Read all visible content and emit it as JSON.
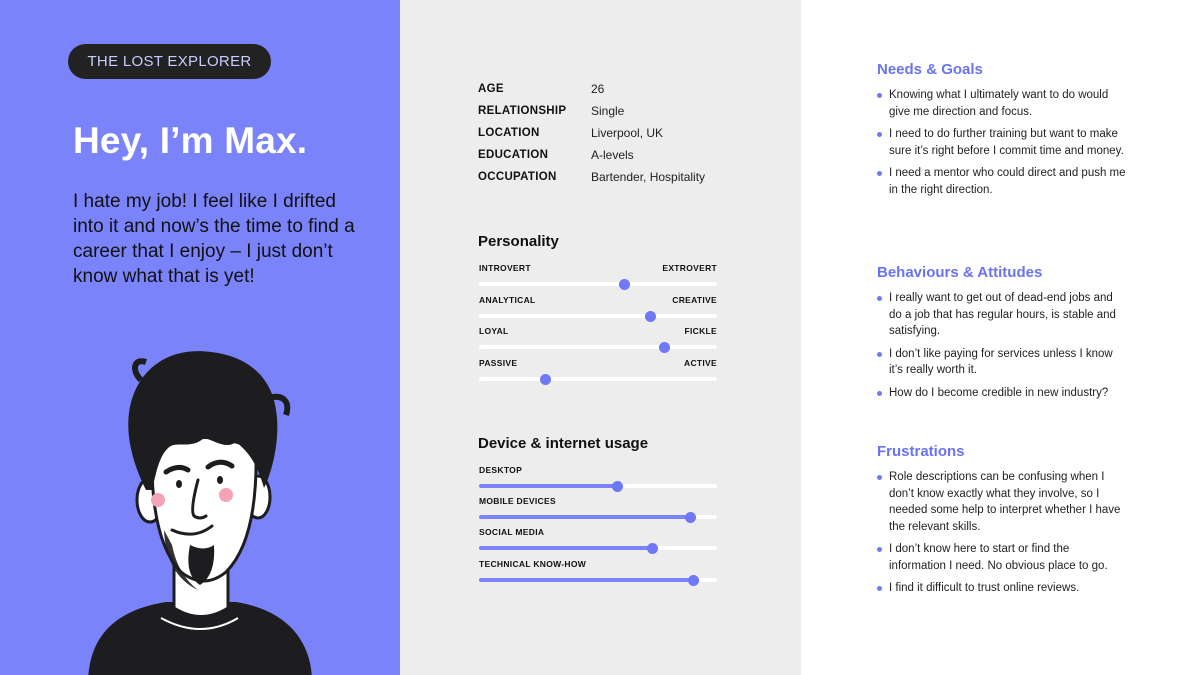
{
  "persona": {
    "badge": "THE LOST EXPLORER",
    "greeting": "Hey, I’m Max.",
    "intro": "I hate my job! I feel like I drifted into it and now’s the time to find a career that I enjoy – I just don’t know what that is yet!"
  },
  "profile": [
    {
      "label": "AGE",
      "value": "26"
    },
    {
      "label": "RELATIONSHIP",
      "value": "Single"
    },
    {
      "label": "LOCATION",
      "value": "Liverpool, UK"
    },
    {
      "label": "EDUCATION",
      "value": "A-levels"
    },
    {
      "label": "OCCUPATION",
      "value": "Bartender, Hospitality"
    }
  ],
  "personality": {
    "title": "Personality",
    "scales": [
      {
        "left": "INTROVERT",
        "right": "EXTROVERT",
        "level": 0.61
      },
      {
        "left": "ANALYTICAL",
        "right": "CREATIVE",
        "level": 0.72
      },
      {
        "left": "LOYAL",
        "right": "FICKLE",
        "level": 0.78
      },
      {
        "left": "PASSIVE",
        "right": "ACTIVE",
        "level": 0.28
      }
    ]
  },
  "device_usage": {
    "title": "Device & internet usage",
    "items": [
      {
        "label": "DESKTOP",
        "level": 0.58
      },
      {
        "label": "MOBILE DEVICES",
        "level": 0.89
      },
      {
        "label": "SOCIAL MEDIA",
        "level": 0.73
      },
      {
        "label": "TECHNICAL KNOW-HOW",
        "level": 0.9
      }
    ]
  },
  "needs_goals": {
    "title": "Needs & Goals",
    "items": [
      "Knowing what I ultimately want to do would give me direction and focus.",
      "I need to do further training but want to make sure it’s right before I commit time and money.",
      "I need a mentor who could direct and push me in the right direction."
    ]
  },
  "behaviours": {
    "title": "Behaviours & Attitudes",
    "items": [
      "I really want to get out of dead-end jobs and do a job that has regular hours, is stable and satisfying.",
      "I don’t like paying for services unless I know it’s really worth it.",
      "How do I become credible in new industry?"
    ]
  },
  "frustrations": {
    "title": "Frustrations",
    "items": [
      "Role descriptions can be confusing when I don’t know exactly what they involve, so I needed some help to interpret whether I have the relevant skills.",
      "I don’t know here to start or find the information I need. No obvious place to go.",
      "I find it difficult to trust online reviews."
    ]
  },
  "colors": {
    "accent": "#7b83fa",
    "heading": "#6a73f0",
    "badge_bg": "#222222",
    "mid_panel": "#ededed"
  }
}
